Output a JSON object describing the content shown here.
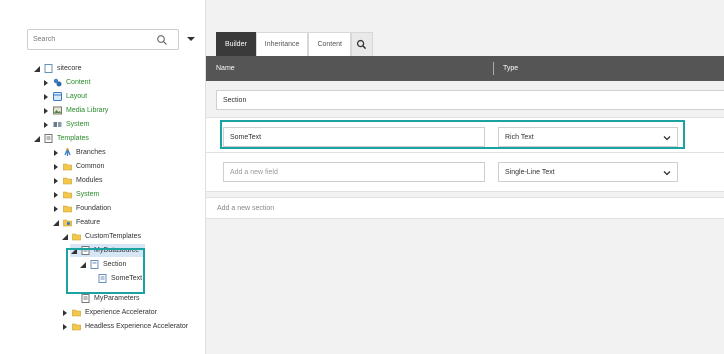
{
  "search": {
    "placeholder": "Search"
  },
  "tree": [
    {
      "label": "sitecore",
      "color": "dark",
      "icon": "page-icon",
      "arrow": "down"
    },
    {
      "label": "Content",
      "color": "green",
      "icon": "content-icon",
      "arrow": "right"
    },
    {
      "label": "Layout",
      "color": "green",
      "icon": "layout-icon",
      "arrow": "right"
    },
    {
      "label": "Media Library",
      "color": "green",
      "icon": "media-library-icon",
      "arrow": "right"
    },
    {
      "label": "System",
      "color": "green",
      "icon": "system-icon",
      "arrow": "right"
    },
    {
      "label": "Templates",
      "color": "green",
      "icon": "templates-icon",
      "arrow": "down"
    },
    {
      "label": "Branches",
      "color": "dark",
      "icon": "branches-icon",
      "arrow": "right"
    },
    {
      "label": "Common",
      "color": "dark",
      "icon": "folder-icon",
      "arrow": "right"
    },
    {
      "label": "Modules",
      "color": "dark",
      "icon": "folder-icon",
      "arrow": "right"
    },
    {
      "label": "System",
      "color": "green",
      "icon": "folder-icon",
      "arrow": "right"
    },
    {
      "label": "Foundation",
      "color": "dark",
      "icon": "folder-icon",
      "arrow": "right"
    },
    {
      "label": "Feature",
      "color": "dark",
      "icon": "feature-folder-icon",
      "arrow": "down"
    },
    {
      "label": "CustomTemplates",
      "color": "dark",
      "icon": "folder-icon",
      "arrow": "down"
    },
    {
      "label": "MyDatasource",
      "color": "dark",
      "icon": "template-icon",
      "arrow": "down"
    },
    {
      "label": "Section",
      "color": "dark",
      "icon": "section-icon",
      "arrow": "down"
    },
    {
      "label": "SomeText",
      "color": "dark",
      "icon": "field-icon",
      "arrow": "none"
    },
    {
      "label": "MyParameters",
      "color": "dark",
      "icon": "template-icon",
      "arrow": "none"
    },
    {
      "label": "Experience Accelerator",
      "color": "dark",
      "icon": "folder-icon",
      "arrow": "right"
    },
    {
      "label": "Headless Experience Accelerator",
      "color": "dark",
      "icon": "folder-icon",
      "arrow": "right"
    }
  ],
  "tabs": [
    "Builder",
    "Inheritance",
    "Content"
  ],
  "header": {
    "name": "Name",
    "type": "Type"
  },
  "section": {
    "value": "Section"
  },
  "fields": [
    {
      "name": "SomeText",
      "type": "Rich Text"
    },
    {
      "placeholder": "Add a new field",
      "type": "Single-Line Text"
    }
  ],
  "add_section": "Add a new section",
  "colors": {
    "teal": "#1aa3a0",
    "header": "#555555",
    "tab_active": "#3a3a3a",
    "tree_green": "#2a8a2a"
  }
}
